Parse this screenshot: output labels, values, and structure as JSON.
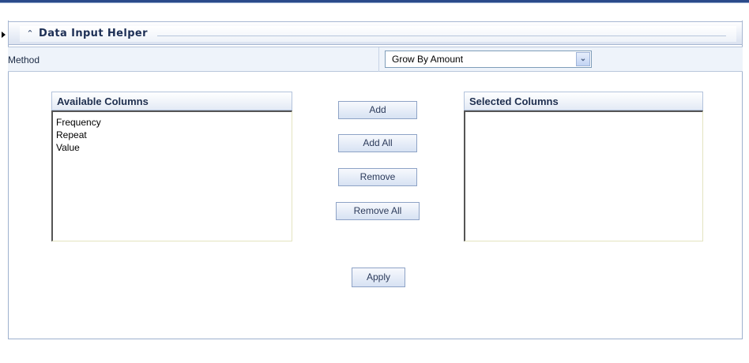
{
  "header": {
    "title": "Data Input Helper",
    "collapse_icon": "double-chevron-up-icon"
  },
  "method": {
    "label": "Method",
    "selected": "Grow By Amount",
    "dropdown_icon": "chevron-down-icon"
  },
  "available": {
    "title": "Available Columns",
    "items": [
      "Frequency",
      "Repeat",
      "Value"
    ]
  },
  "selected": {
    "title": "Selected Columns",
    "items": []
  },
  "buttons": {
    "add": "Add",
    "add_all": "Add All",
    "remove": "Remove",
    "remove_all": "Remove All",
    "apply": "Apply"
  },
  "colors": {
    "header_text": "#1d2f55",
    "border": "#9eb1cf",
    "accent_rule": "#2b4a8a"
  }
}
